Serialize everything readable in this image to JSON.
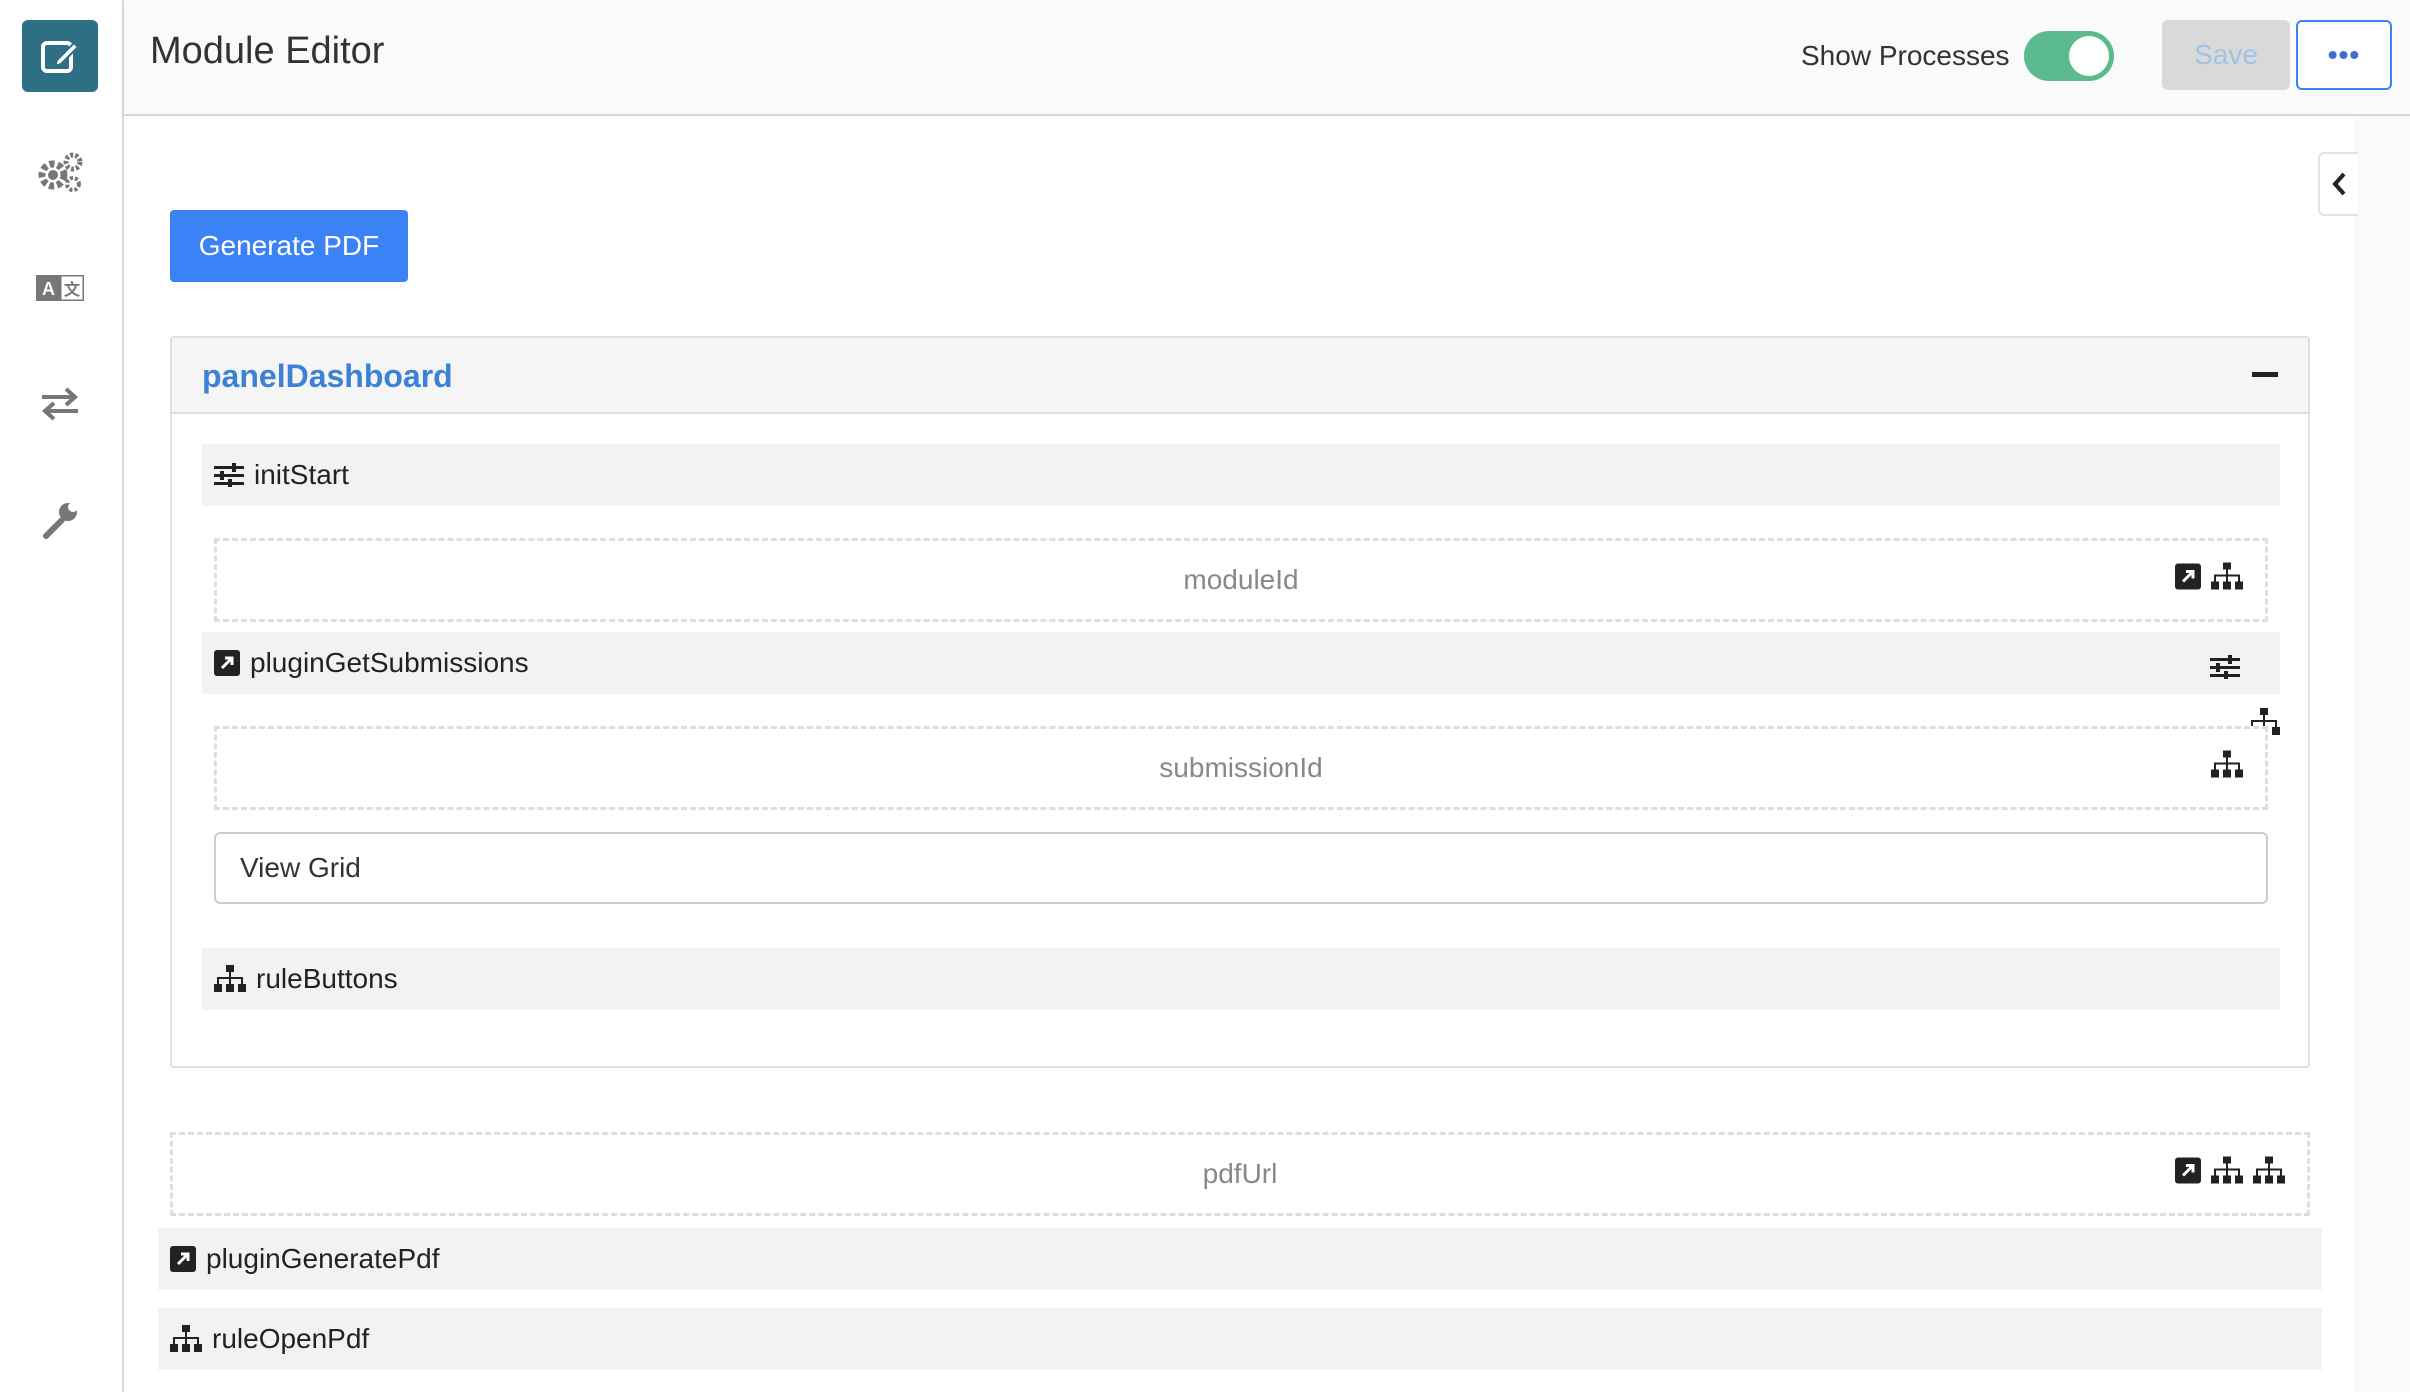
{
  "header": {
    "title": "Module Editor",
    "toggle_label": "Show Processes",
    "toggle_on": true,
    "save_label": "Save",
    "more_label": "•••"
  },
  "sidebar": {
    "items": [
      {
        "name": "edit-icon",
        "active": true
      },
      {
        "name": "gears-icon",
        "active": false
      },
      {
        "name": "translate-icon",
        "active": false
      },
      {
        "name": "exchange-icon",
        "active": false
      },
      {
        "name": "wrench-icon",
        "active": false
      }
    ]
  },
  "colors": {
    "rail_active": "#2e6f86",
    "primary": "#3b82f6",
    "panel_title": "#3b82d6",
    "toggle_on": "#5cba8f"
  },
  "main": {
    "generate_button": "Generate PDF",
    "panel": {
      "title": "panelDashboard",
      "rows": {
        "init_start": "initStart",
        "module_id": "moduleId",
        "plugin_get_submissions": "pluginGetSubmissions",
        "submission_id": "submissionId",
        "view_grid": "View Grid",
        "rule_buttons": "ruleButtons"
      }
    },
    "pdf_url": "pdfUrl",
    "plugin_generate_pdf": "pluginGeneratePdf",
    "rule_open_pdf": "ruleOpenPdf"
  }
}
